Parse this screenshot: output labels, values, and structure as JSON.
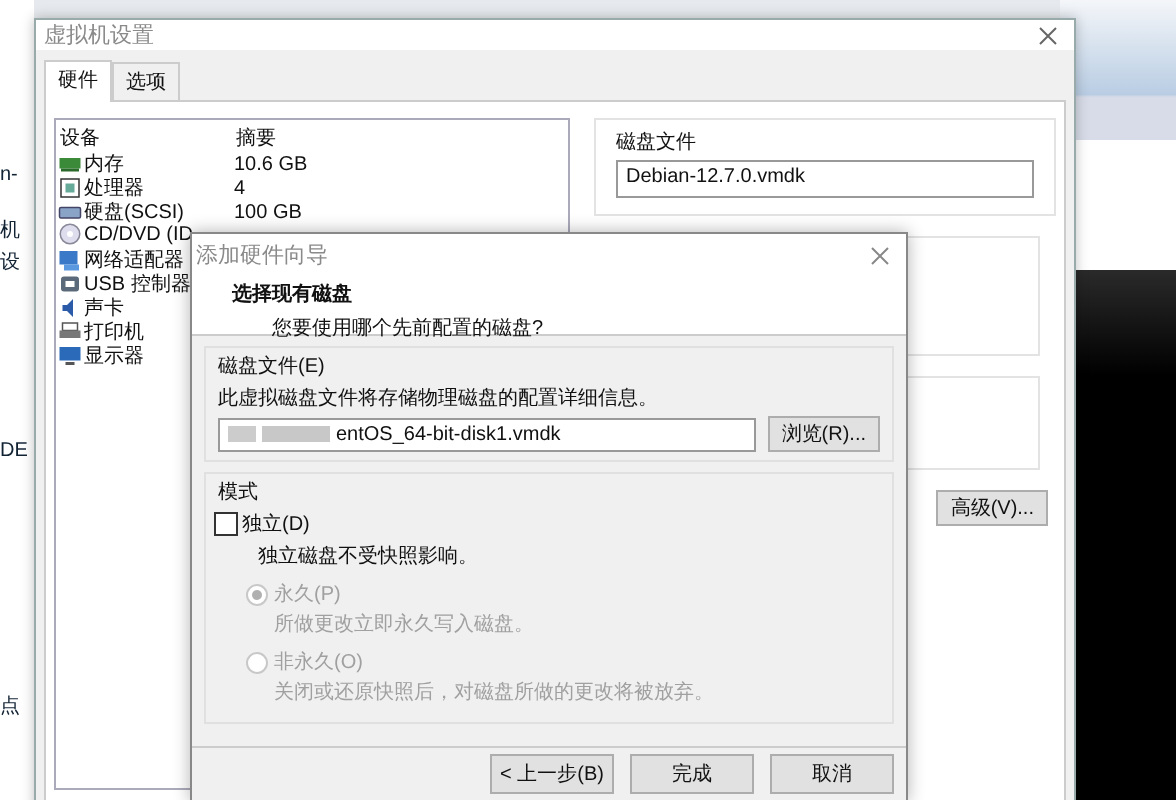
{
  "background_app": {
    "fragments": [
      "n-",
      "机",
      "设",
      "DE",
      "点"
    ]
  },
  "settings_window": {
    "title": "虚拟机设置",
    "tabs": [
      {
        "label": "硬件",
        "selected": true
      },
      {
        "label": "选项",
        "selected": false
      }
    ],
    "device_table": {
      "columns": [
        "设备",
        "摘要"
      ],
      "rows": [
        {
          "device": "内存",
          "summary": "10.6 GB"
        },
        {
          "device": "处理器",
          "summary": "4"
        },
        {
          "device": "硬盘(SCSI)",
          "summary": "100 GB"
        },
        {
          "device": "CD/DVD (ID",
          "summary": ""
        },
        {
          "device": "网络适配器",
          "summary": ""
        },
        {
          "device": "USB 控制器",
          "summary": ""
        },
        {
          "device": "声卡",
          "summary": ""
        },
        {
          "device": "打印机",
          "summary": ""
        },
        {
          "device": "显示器",
          "summary": ""
        }
      ]
    },
    "disk_file": {
      "label": "磁盘文件",
      "value": "Debian-12.7.0.vmdk"
    },
    "advanced_button": "高级(V)..."
  },
  "wizard": {
    "title": "添加硬件向导",
    "heading": "选择现有磁盘",
    "subheading": "您要使用哪个先前配置的磁盘?",
    "disk_file": {
      "label": "磁盘文件(E)",
      "description": "此虚拟磁盘文件将存储物理磁盘的配置详细信息。",
      "value": "entOS_64-bit-disk1.vmdk",
      "browse_button": "浏览(R)..."
    },
    "mode": {
      "label": "模式",
      "independent": {
        "label": "独立(D)",
        "checked": false
      },
      "note": "独立磁盘不受快照影响。",
      "options": [
        {
          "label": "永久(P)",
          "description": "所做更改立即永久写入磁盘。",
          "selected": true,
          "disabled": true
        },
        {
          "label": "非永久(O)",
          "description": "关闭或还原快照后，对磁盘所做的更改将被放弃。",
          "selected": false,
          "disabled": true
        }
      ]
    },
    "buttons": [
      "< 上一步(B)",
      "完成",
      "取消"
    ]
  }
}
